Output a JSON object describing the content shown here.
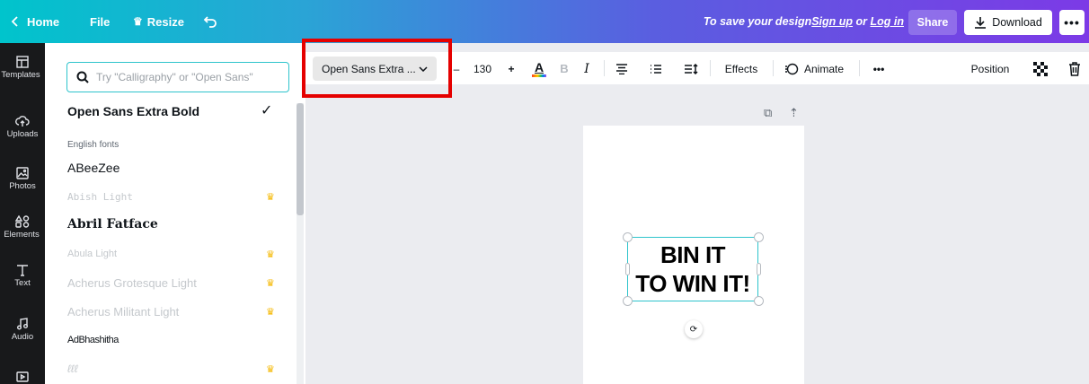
{
  "topbar": {
    "home": "Home",
    "file": "File",
    "resize": "Resize",
    "save_prefix": "To save your design ",
    "sign_up": "Sign up",
    "or": " or ",
    "log_in": "Log in",
    "share": "Share",
    "download": "Download",
    "more": "•••"
  },
  "rail": [
    {
      "label": "Templates",
      "icon": "templates-icon"
    },
    {
      "label": "Uploads",
      "icon": "uploads-icon"
    },
    {
      "label": "Photos",
      "icon": "photos-icon"
    },
    {
      "label": "Elements",
      "icon": "elements-icon"
    },
    {
      "label": "Text",
      "icon": "text-icon"
    },
    {
      "label": "Audio",
      "icon": "audio-icon"
    },
    {
      "label": "",
      "icon": "video-icon"
    }
  ],
  "font_panel": {
    "search_placeholder": "Try \"Calligraphy\" or \"Open Sans\"",
    "selected_font": "Open Sans Extra Bold",
    "group_title": "English fonts",
    "fonts": [
      {
        "name": "ABeeZee",
        "pro": false
      },
      {
        "name": "Abish Light",
        "pro": true
      },
      {
        "name": "Abril Fatface",
        "pro": false
      },
      {
        "name": "Abula Light",
        "pro": true
      },
      {
        "name": "Acherus Grotesque Light",
        "pro": true
      },
      {
        "name": "Acherus Militant Light",
        "pro": true
      },
      {
        "name": "AdBhashitha",
        "pro": false
      },
      {
        "name": "ℓℓℓ",
        "pro": true
      }
    ]
  },
  "toolbar": {
    "font_select": "Open Sans Extra ...",
    "minus": "–",
    "font_size": "130",
    "plus": "+",
    "text_color_letter": "A",
    "bold": "B",
    "italic": "I",
    "effects": "Effects",
    "animate": "Animate",
    "more": "•••",
    "position": "Position"
  },
  "canvas": {
    "line1": "BIN IT",
    "line2": "TO WIN IT!"
  },
  "colors": {
    "accent": "#2ec4cc",
    "highlight": "#e50000",
    "crown": "#f5b800"
  }
}
